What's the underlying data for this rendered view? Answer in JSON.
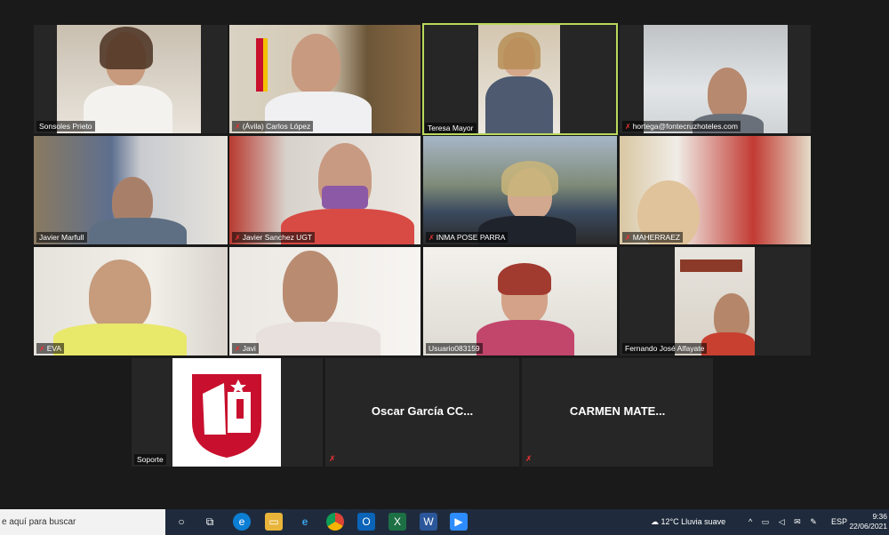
{
  "participants": [
    {
      "name": "Sonsoles Prieto",
      "muted": false
    },
    {
      "name": "(Ávila) Carlos López",
      "muted": true
    },
    {
      "name": "Teresa Mayor",
      "muted": false
    },
    {
      "name": "hortega@fontecruzhoteles.com",
      "muted": true
    },
    {
      "name": "Javier Marfull",
      "muted": false
    },
    {
      "name": "Javier Sanchez UGT",
      "muted": true
    },
    {
      "name": "INMA POSE PARRA",
      "muted": true
    },
    {
      "name": "MAHERRAEZ",
      "muted": true
    },
    {
      "name": "EVA",
      "muted": true
    },
    {
      "name": "Javi",
      "muted": true
    },
    {
      "name": "Usuario083159",
      "muted": false
    },
    {
      "name": "Fernando José Alfayate",
      "muted": false
    },
    {
      "name": "Soporte",
      "muted": false
    },
    {
      "name": "Oscar García CC...",
      "muted": true
    },
    {
      "name": "CARMEN  MATE...",
      "muted": true
    }
  ],
  "colors": {
    "active_speaker": "#b8d95a",
    "muted_icon": "#e33333",
    "logo_red": "#c8102e"
  },
  "taskbar": {
    "search_text": "e aquí para buscar",
    "weather": "12°C  Lluvia suave",
    "lang": "ESP",
    "time": "9:36",
    "date": "22/06/2021",
    "apps": [
      "task-view",
      "edge",
      "file-explorer",
      "internet-explorer",
      "chrome",
      "outlook",
      "excel",
      "word",
      "zoom"
    ]
  }
}
